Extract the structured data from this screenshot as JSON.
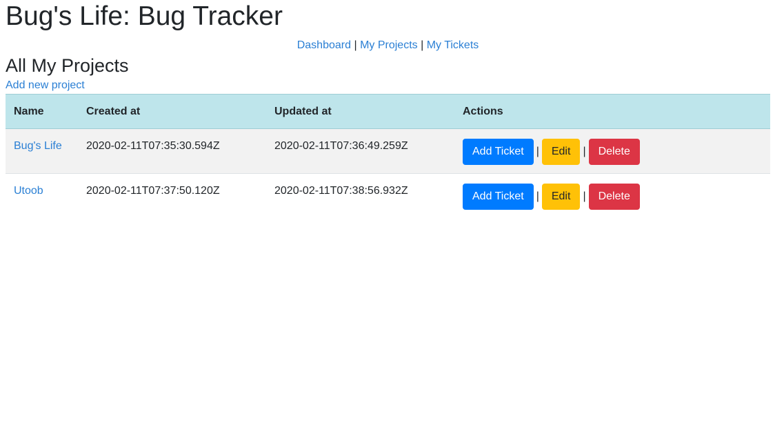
{
  "app": {
    "title": "Bug's Life: Bug Tracker"
  },
  "nav": {
    "items": [
      {
        "label": "Dashboard"
      },
      {
        "label": "My Projects"
      },
      {
        "label": "My Tickets"
      }
    ],
    "separator": "|"
  },
  "main": {
    "heading": "All My Projects",
    "add_link": "Add new project",
    "table": {
      "columns": [
        "Name",
        "Created at",
        "Updated at",
        "Actions"
      ],
      "rows": [
        {
          "name": "Bug's Life",
          "created_at": "2020-02-11T07:35:30.594Z",
          "updated_at": "2020-02-11T07:36:49.259Z"
        },
        {
          "name": "Utoob",
          "created_at": "2020-02-11T07:37:50.120Z",
          "updated_at": "2020-02-11T07:38:56.932Z"
        }
      ],
      "actions": {
        "add_ticket": "Add Ticket",
        "edit": "Edit",
        "delete": "Delete",
        "separator": "|"
      }
    }
  },
  "colors": {
    "link": "#2a7fd4",
    "header_bg": "#bee5eb",
    "striped_row": "#f2f2f2",
    "primary": "#007bff",
    "warning": "#ffc107",
    "danger": "#dc3545"
  }
}
